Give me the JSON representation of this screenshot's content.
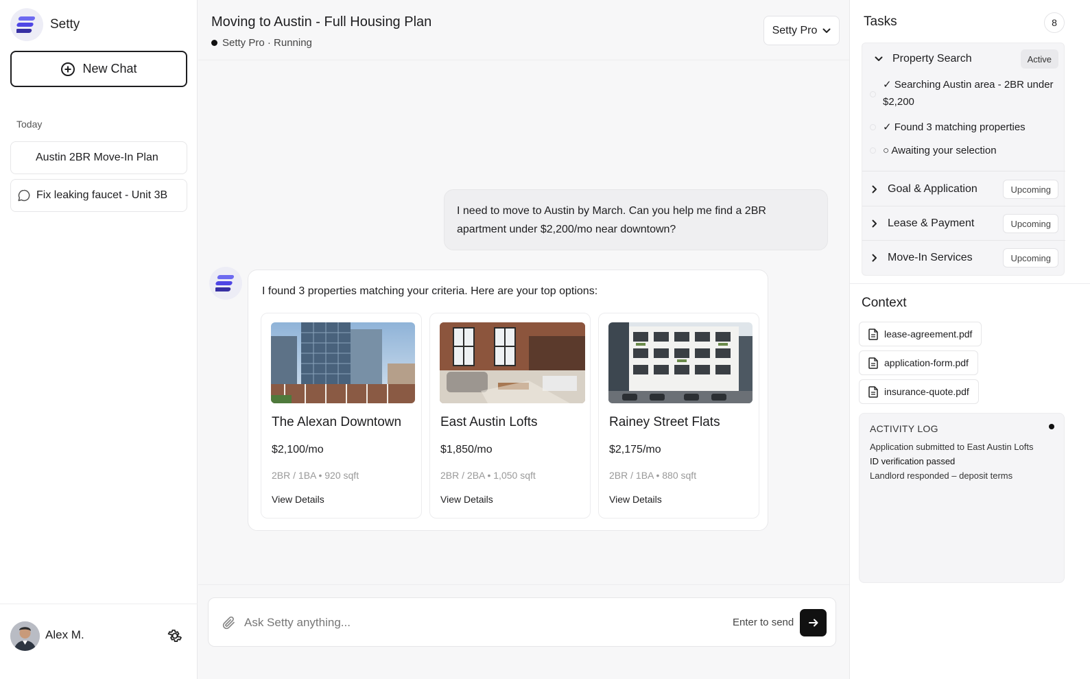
{
  "brand": {
    "name": "Setty"
  },
  "sidebar": {
    "new_chat_label": "New Chat",
    "section_label": "Today",
    "chats": [
      {
        "label": "Austin 2BR Move-In Plan"
      },
      {
        "label": "Fix leaking faucet - Unit 3B"
      }
    ],
    "user": {
      "name": "Alex M."
    }
  },
  "header": {
    "title": "Moving to Austin - Full Housing Plan",
    "status": "Setty Pro · Running",
    "model": "Setty Pro"
  },
  "conversation": {
    "user_message": "I need to move to Austin by March. Can you help me find a 2BR apartment under $2,200/mo near downtown?",
    "bot_message": "I found 3 properties matching your criteria. Here are your top options:",
    "properties": [
      {
        "name": "The Alexan Downtown",
        "price": "$2,100/mo",
        "specs": "2BR / 1BA • 920 sqft",
        "link": "View Details"
      },
      {
        "name": "East Austin Lofts",
        "price": "$1,850/mo",
        "specs": "2BR / 2BA • 1,050 sqft",
        "link": "View Details"
      },
      {
        "name": "Rainey Street Flats",
        "price": "$2,175/mo",
        "specs": "2BR / 1BA • 880 sqft",
        "link": "View Details"
      }
    ]
  },
  "composer": {
    "placeholder": "Ask Setty anything...",
    "hint": "Enter to send"
  },
  "tasks": {
    "title": "Tasks",
    "count": "8",
    "groups": [
      {
        "label": "Property Search",
        "status": "Active",
        "items": [
          {
            "text": "✓ Searching Austin area - 2BR under $2,200"
          },
          {
            "text": "✓ Found 3 matching properties"
          },
          {
            "text": "○ Awaiting your selection"
          }
        ]
      },
      {
        "label": "Goal & Application",
        "status": "Upcoming"
      },
      {
        "label": "Lease & Payment",
        "status": "Upcoming"
      },
      {
        "label": "Move-In Services",
        "status": "Upcoming"
      }
    ]
  },
  "context": {
    "title": "Context",
    "files": [
      {
        "name": "lease-agreement.pdf"
      },
      {
        "name": "application-form.pdf"
      },
      {
        "name": "insurance-quote.pdf"
      }
    ],
    "activity": {
      "title": "ACTIVITY LOG",
      "entries": [
        "Application submitted to East Austin Lofts",
        "ID verification passed",
        "Landlord responded – deposit terms"
      ]
    }
  },
  "colors": {
    "accent": "#4f46e5",
    "accent_light": "#6d6af0",
    "logo_bg": "#ededf6"
  }
}
